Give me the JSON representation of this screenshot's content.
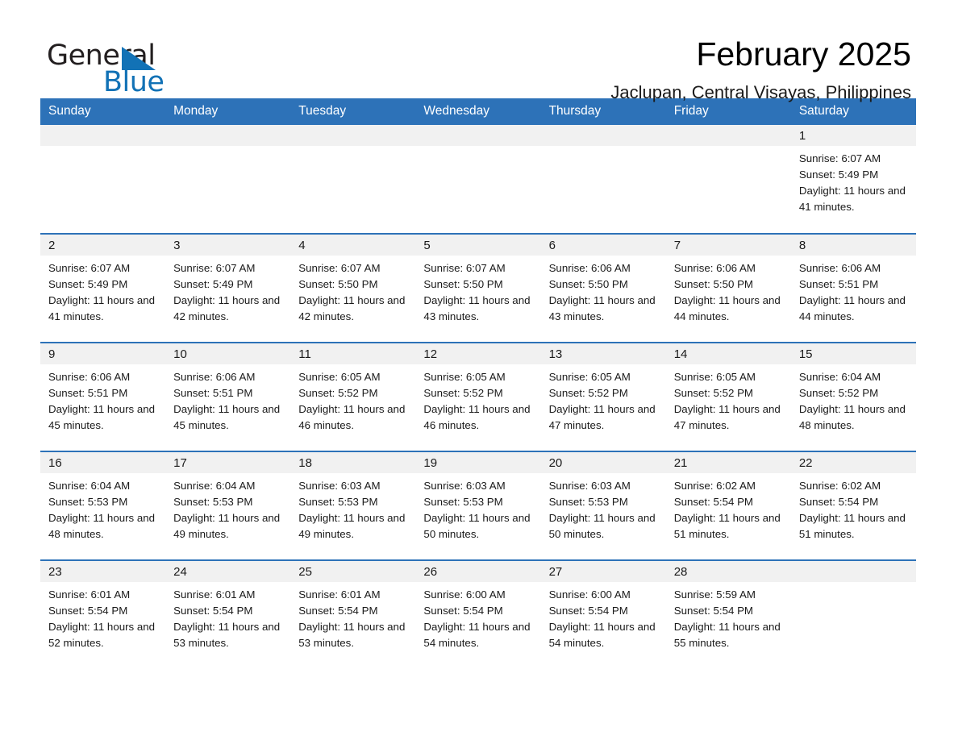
{
  "brand": {
    "name_part1": "General",
    "name_part2": "Blue",
    "logo_icon": "triangle-flag-icon",
    "color_primary": "#1272b6"
  },
  "header": {
    "title": "February 2025",
    "subtitle": "Jaclupan, Central Visayas, Philippines"
  },
  "calendar": {
    "header_bg": "#2d72b8",
    "daynum_bg": "#f1f1f1",
    "weekdays": [
      "Sunday",
      "Monday",
      "Tuesday",
      "Wednesday",
      "Thursday",
      "Friday",
      "Saturday"
    ],
    "weeks": [
      [
        {
          "day": "",
          "sunrise": "",
          "sunset": "",
          "daylight": "",
          "blank": true
        },
        {
          "day": "",
          "sunrise": "",
          "sunset": "",
          "daylight": "",
          "blank": true
        },
        {
          "day": "",
          "sunrise": "",
          "sunset": "",
          "daylight": "",
          "blank": true
        },
        {
          "day": "",
          "sunrise": "",
          "sunset": "",
          "daylight": "",
          "blank": true
        },
        {
          "day": "",
          "sunrise": "",
          "sunset": "",
          "daylight": "",
          "blank": true
        },
        {
          "day": "",
          "sunrise": "",
          "sunset": "",
          "daylight": "",
          "blank": true
        },
        {
          "day": "1",
          "sunrise": "Sunrise: 6:07 AM",
          "sunset": "Sunset: 5:49 PM",
          "daylight": "Daylight: 11 hours and 41 minutes.",
          "blank": false
        }
      ],
      [
        {
          "day": "2",
          "sunrise": "Sunrise: 6:07 AM",
          "sunset": "Sunset: 5:49 PM",
          "daylight": "Daylight: 11 hours and 41 minutes.",
          "blank": false
        },
        {
          "day": "3",
          "sunrise": "Sunrise: 6:07 AM",
          "sunset": "Sunset: 5:49 PM",
          "daylight": "Daylight: 11 hours and 42 minutes.",
          "blank": false
        },
        {
          "day": "4",
          "sunrise": "Sunrise: 6:07 AM",
          "sunset": "Sunset: 5:50 PM",
          "daylight": "Daylight: 11 hours and 42 minutes.",
          "blank": false
        },
        {
          "day": "5",
          "sunrise": "Sunrise: 6:07 AM",
          "sunset": "Sunset: 5:50 PM",
          "daylight": "Daylight: 11 hours and 43 minutes.",
          "blank": false
        },
        {
          "day": "6",
          "sunrise": "Sunrise: 6:06 AM",
          "sunset": "Sunset: 5:50 PM",
          "daylight": "Daylight: 11 hours and 43 minutes.",
          "blank": false
        },
        {
          "day": "7",
          "sunrise": "Sunrise: 6:06 AM",
          "sunset": "Sunset: 5:50 PM",
          "daylight": "Daylight: 11 hours and 44 minutes.",
          "blank": false
        },
        {
          "day": "8",
          "sunrise": "Sunrise: 6:06 AM",
          "sunset": "Sunset: 5:51 PM",
          "daylight": "Daylight: 11 hours and 44 minutes.",
          "blank": false
        }
      ],
      [
        {
          "day": "9",
          "sunrise": "Sunrise: 6:06 AM",
          "sunset": "Sunset: 5:51 PM",
          "daylight": "Daylight: 11 hours and 45 minutes.",
          "blank": false
        },
        {
          "day": "10",
          "sunrise": "Sunrise: 6:06 AM",
          "sunset": "Sunset: 5:51 PM",
          "daylight": "Daylight: 11 hours and 45 minutes.",
          "blank": false
        },
        {
          "day": "11",
          "sunrise": "Sunrise: 6:05 AM",
          "sunset": "Sunset: 5:52 PM",
          "daylight": "Daylight: 11 hours and 46 minutes.",
          "blank": false
        },
        {
          "day": "12",
          "sunrise": "Sunrise: 6:05 AM",
          "sunset": "Sunset: 5:52 PM",
          "daylight": "Daylight: 11 hours and 46 minutes.",
          "blank": false
        },
        {
          "day": "13",
          "sunrise": "Sunrise: 6:05 AM",
          "sunset": "Sunset: 5:52 PM",
          "daylight": "Daylight: 11 hours and 47 minutes.",
          "blank": false
        },
        {
          "day": "14",
          "sunrise": "Sunrise: 6:05 AM",
          "sunset": "Sunset: 5:52 PM",
          "daylight": "Daylight: 11 hours and 47 minutes.",
          "blank": false
        },
        {
          "day": "15",
          "sunrise": "Sunrise: 6:04 AM",
          "sunset": "Sunset: 5:52 PM",
          "daylight": "Daylight: 11 hours and 48 minutes.",
          "blank": false
        }
      ],
      [
        {
          "day": "16",
          "sunrise": "Sunrise: 6:04 AM",
          "sunset": "Sunset: 5:53 PM",
          "daylight": "Daylight: 11 hours and 48 minutes.",
          "blank": false
        },
        {
          "day": "17",
          "sunrise": "Sunrise: 6:04 AM",
          "sunset": "Sunset: 5:53 PM",
          "daylight": "Daylight: 11 hours and 49 minutes.",
          "blank": false
        },
        {
          "day": "18",
          "sunrise": "Sunrise: 6:03 AM",
          "sunset": "Sunset: 5:53 PM",
          "daylight": "Daylight: 11 hours and 49 minutes.",
          "blank": false
        },
        {
          "day": "19",
          "sunrise": "Sunrise: 6:03 AM",
          "sunset": "Sunset: 5:53 PM",
          "daylight": "Daylight: 11 hours and 50 minutes.",
          "blank": false
        },
        {
          "day": "20",
          "sunrise": "Sunrise: 6:03 AM",
          "sunset": "Sunset: 5:53 PM",
          "daylight": "Daylight: 11 hours and 50 minutes.",
          "blank": false
        },
        {
          "day": "21",
          "sunrise": "Sunrise: 6:02 AM",
          "sunset": "Sunset: 5:54 PM",
          "daylight": "Daylight: 11 hours and 51 minutes.",
          "blank": false
        },
        {
          "day": "22",
          "sunrise": "Sunrise: 6:02 AM",
          "sunset": "Sunset: 5:54 PM",
          "daylight": "Daylight: 11 hours and 51 minutes.",
          "blank": false
        }
      ],
      [
        {
          "day": "23",
          "sunrise": "Sunrise: 6:01 AM",
          "sunset": "Sunset: 5:54 PM",
          "daylight": "Daylight: 11 hours and 52 minutes.",
          "blank": false
        },
        {
          "day": "24",
          "sunrise": "Sunrise: 6:01 AM",
          "sunset": "Sunset: 5:54 PM",
          "daylight": "Daylight: 11 hours and 53 minutes.",
          "blank": false
        },
        {
          "day": "25",
          "sunrise": "Sunrise: 6:01 AM",
          "sunset": "Sunset: 5:54 PM",
          "daylight": "Daylight: 11 hours and 53 minutes.",
          "blank": false
        },
        {
          "day": "26",
          "sunrise": "Sunrise: 6:00 AM",
          "sunset": "Sunset: 5:54 PM",
          "daylight": "Daylight: 11 hours and 54 minutes.",
          "blank": false
        },
        {
          "day": "27",
          "sunrise": "Sunrise: 6:00 AM",
          "sunset": "Sunset: 5:54 PM",
          "daylight": "Daylight: 11 hours and 54 minutes.",
          "blank": false
        },
        {
          "day": "28",
          "sunrise": "Sunrise: 5:59 AM",
          "sunset": "Sunset: 5:54 PM",
          "daylight": "Daylight: 11 hours and 55 minutes.",
          "blank": false
        },
        {
          "day": "",
          "sunrise": "",
          "sunset": "",
          "daylight": "",
          "blank": true
        }
      ]
    ]
  }
}
